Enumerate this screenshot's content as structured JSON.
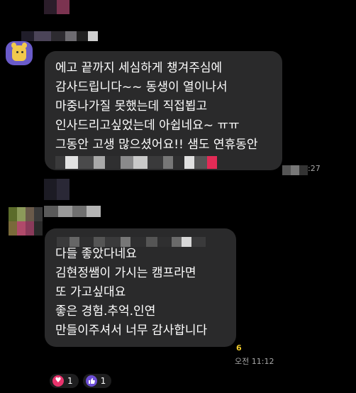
{
  "messages": [
    {
      "lines": [
        "에고 끝까지 세심하게 챙겨주심에",
        "감사드립니다~~ 동생이 열이나서",
        "마중나가질 못했는데 직접뵙고",
        "인사드리고싶었는데 아쉽네요~ ㅠㅠ",
        "그동안 고생 많으셨어요!! 샘도 연휴동안"
      ],
      "time": ":27"
    },
    {
      "lines": [
        "다들 좋았다네요",
        "김현정쌤이 가시는 캠프라면",
        "또 가고싶대요",
        "좋은 경험.추억.인연",
        "만들이주셔서 너무 감사합니다"
      ],
      "unread_count": "6",
      "time": "오전 11:12"
    }
  ],
  "reactions": [
    {
      "icon": "heart-icon",
      "count": "1"
    },
    {
      "icon": "thumbs-up-icon",
      "count": "1"
    }
  ],
  "colors": {
    "background": "#000000",
    "bubble": "#2a2a2b",
    "unread": "#f2cc2b",
    "heart": "#e8336c",
    "thumb": "#6d4ed6"
  }
}
